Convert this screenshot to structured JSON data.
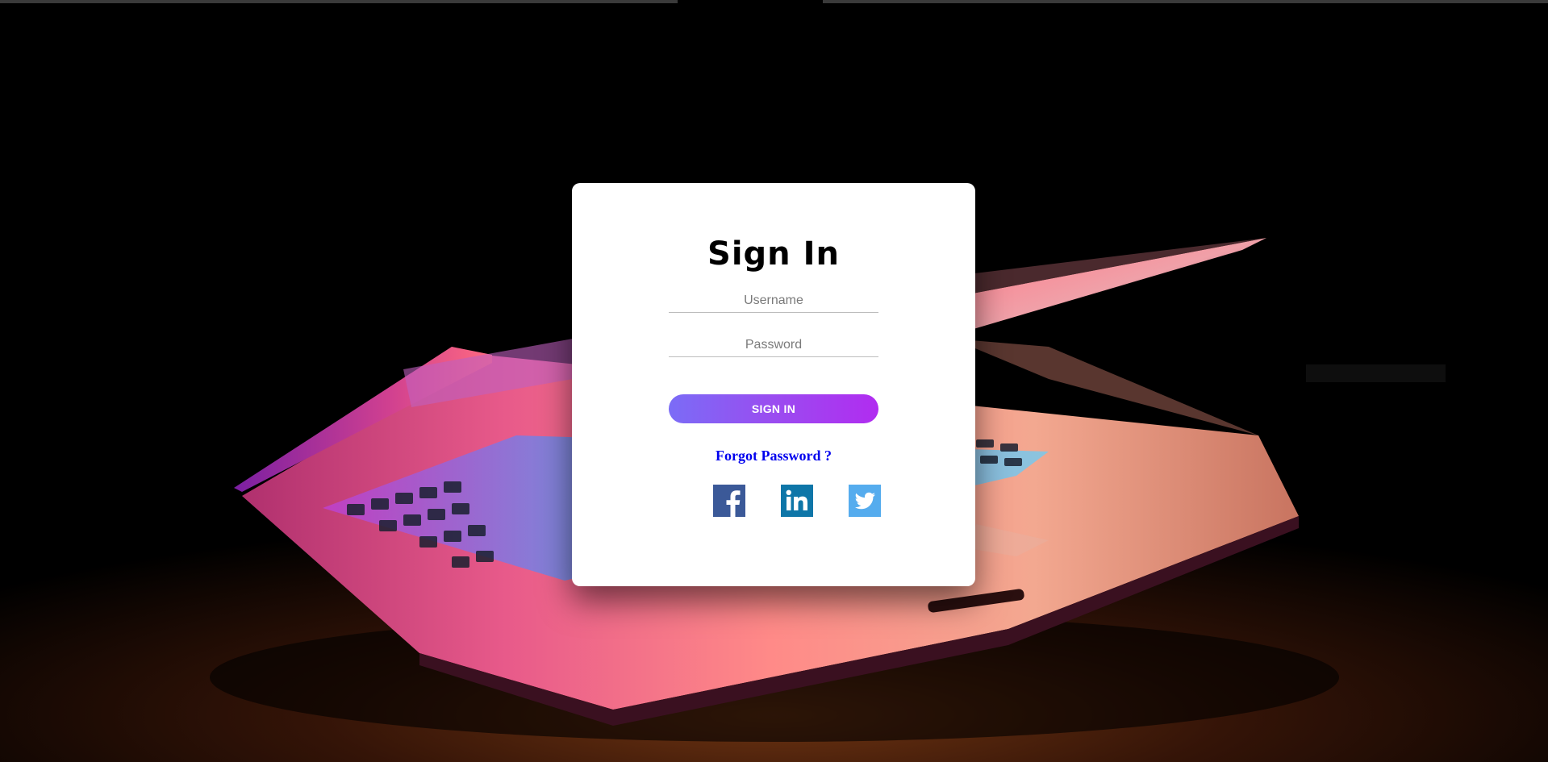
{
  "login": {
    "title": "Sign In",
    "username_placeholder": "Username",
    "password_placeholder": "Password",
    "signin_label": "SIGN IN",
    "forgot_label": "Forgot Password ?"
  },
  "socials": [
    {
      "name": "facebook-icon",
      "color": "#3b5998"
    },
    {
      "name": "linkedin-icon",
      "color": "#0e76a8"
    },
    {
      "name": "twitter-icon",
      "color": "#55acee"
    }
  ],
  "colors": {
    "button_gradient_start": "#7b6cf6",
    "button_gradient_end": "#b12cf0",
    "link": "#0000ee"
  }
}
